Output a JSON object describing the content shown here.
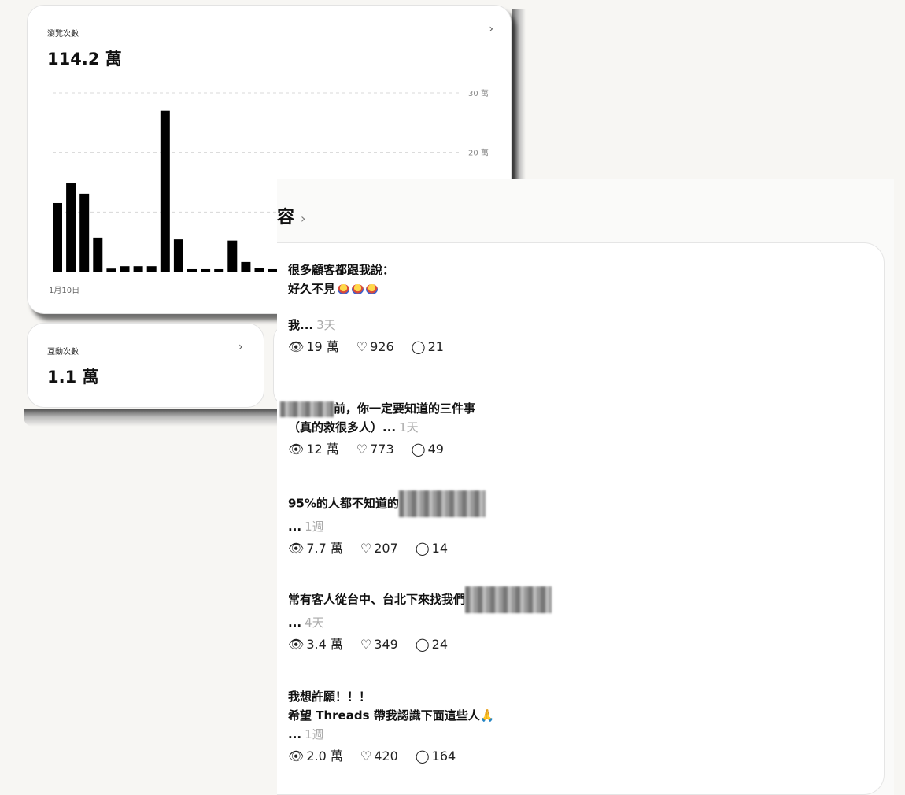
{
  "views_card": {
    "label": "瀏覽次數",
    "value": "114.2 萬",
    "chevron": "›",
    "x_start_label": "1月10日"
  },
  "engagement_card": {
    "label": "互動次數",
    "value": "1.1 萬",
    "chevron": "›"
  },
  "chart_data": {
    "type": "bar",
    "values": [
      11.5,
      14.8,
      13.1,
      5.7,
      0.5,
      0.9,
      0.9,
      0.9,
      27.0,
      5.4,
      0.4,
      0.4,
      0.4,
      5.2,
      1.6,
      0.6,
      0.4
    ],
    "ylim": [
      0,
      30
    ],
    "ytick_labels": [
      "30 萬",
      "20 萬"
    ],
    "grid": true
  },
  "posts_section": {
    "title_partial": "容",
    "chevron": "›",
    "posts": [
      {
        "line1": "很多顧客都跟我說：",
        "line2": "好久不見",
        "line3": "我...",
        "age": "3天",
        "views": "19 萬",
        "likes": "926",
        "replies": "21"
      },
      {
        "line1": "前，你一定要知道的三件事",
        "line2": "（真的救很多人）...",
        "age": "1天",
        "views": "12 萬",
        "likes": "773",
        "replies": "49"
      },
      {
        "line1": "95%的人都不知道的",
        "line2": "...",
        "age": "1週",
        "views": "7.7 萬",
        "likes": "207",
        "replies": "14"
      },
      {
        "line1": "常有客人從台中、台北下來找我們",
        "line2": "...",
        "age": "4天",
        "views": "3.4 萬",
        "likes": "349",
        "replies": "24"
      },
      {
        "line1": "我想許願！！！",
        "line2": "希望 Threads 帶我認識下面這些人",
        "line3": "...",
        "age": "1週",
        "views": "2.0 萬",
        "likes": "420",
        "replies": "164"
      }
    ]
  },
  "icons": {
    "views": "eye-icon",
    "likes": "heart-icon",
    "replies": "comment-icon"
  }
}
